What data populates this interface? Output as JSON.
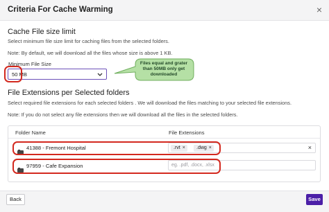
{
  "dialog": {
    "title": "Criteria For Cache Warming",
    "close_glyph": "×"
  },
  "size_section": {
    "heading": "Cache File size limit",
    "description": "Select minimum file size limit for caching files from the selected folders.",
    "note": "Note: By default, we will download all the files whose size is above 1 KB.",
    "field_label": "Minimum File Size",
    "selected_value": "50 MB"
  },
  "annotation": {
    "text": "Files equal and grater than 50MB only get downloaded"
  },
  "ext_section": {
    "heading": "File Extensions per Selected folders",
    "description": "Select required file extensions for each selected folders . We will download the files matching to your selected file extensions.",
    "note": "Note: If you do not select any file extensions then we will download all the files in the selected folders."
  },
  "table": {
    "col_folder": "Folder Name",
    "col_ext": "File Extensions",
    "rows": [
      {
        "folder": "41388 - Fremont Hospital",
        "extensions": [
          ".rvt",
          ".dwg"
        ],
        "placeholder": ""
      },
      {
        "folder": "97959 - Cafe Expansion",
        "extensions": [],
        "placeholder": "eg. .pdf, .docx, .xlsx"
      }
    ]
  },
  "footer": {
    "back_label": "Back",
    "save_label": "Save"
  },
  "colors": {
    "accent": "#4b1fa7",
    "highlight": "#d3281e",
    "callout": "#b5e0a5"
  }
}
